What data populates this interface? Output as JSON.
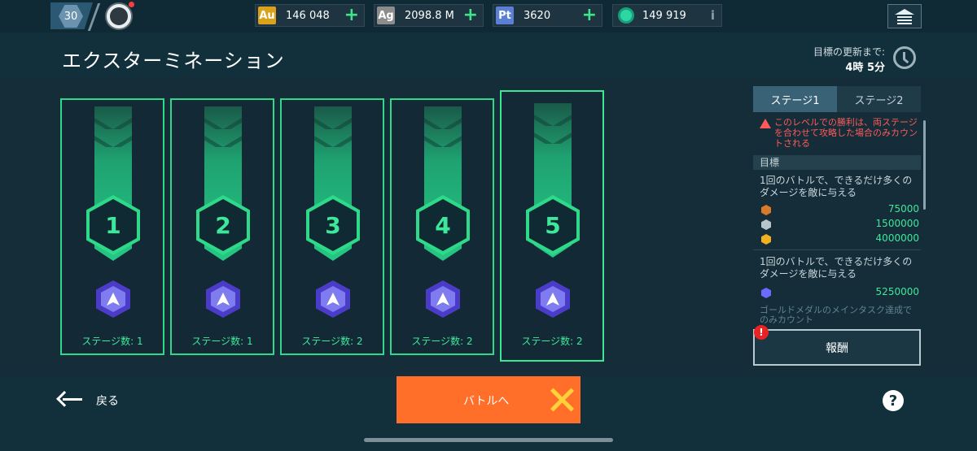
{
  "topbar": {
    "player_level": "30",
    "currencies": [
      {
        "tag": "Au",
        "value": "146 048",
        "color": "#d9a21a"
      },
      {
        "tag": "Ag",
        "value": "2098.8 M",
        "color": "#9a9a9a"
      },
      {
        "tag": "Pt",
        "value": "3620",
        "color": "#5a7fd6"
      }
    ],
    "gems": {
      "value": "149 919",
      "info": "i"
    },
    "icons": [
      "plus-icon",
      "home-icon",
      "gem-icon",
      "info-icon"
    ]
  },
  "header": {
    "title": "エクスターミネーション",
    "refresh_label": "目標の更新まで:",
    "refresh_time": "4時 5分"
  },
  "stages": [
    {
      "number": "1",
      "count": "ステージ数: 1",
      "selected": false
    },
    {
      "number": "2",
      "count": "ステージ数: 1",
      "selected": false
    },
    {
      "number": "3",
      "count": "ステージ数: 2",
      "selected": false
    },
    {
      "number": "4",
      "count": "ステージ数: 2",
      "selected": false
    },
    {
      "number": "5",
      "count": "ステージ数: 2",
      "selected": true
    }
  ],
  "side": {
    "tabs": [
      "ステージ1",
      "ステージ2"
    ],
    "active_tab": "ステージ1",
    "warning": "このレベルでの勝利は、両ステージを合わせて攻略した場合のみカウントされる",
    "goal_header": "目標",
    "objective1": "1回のバトルで、できるだけ多くのダメージを敵に与える",
    "tiers1": [
      {
        "value": "75000",
        "color": "#d97a2a"
      },
      {
        "value": "1500000",
        "color": "#b8c4cc"
      },
      {
        "value": "4000000",
        "color": "#f0b020"
      }
    ],
    "objective2": "1回のバトルで、できるだけ多くのダメージを敵に与える",
    "tiers2": [
      {
        "value": "5250000",
        "color": "#6b6bff"
      }
    ],
    "footnote": "ゴールドメダルのメインタスク達成でのみカウント",
    "reward_button": "報酬",
    "reward_alert": "!"
  },
  "bottom": {
    "back_label": "戻る",
    "battle_label": "バトルへ",
    "help": "?"
  },
  "colors": {
    "accent_green": "#2fd98a",
    "battle_orange": "#ff6f2a",
    "warning_red": "#ff5a5a"
  }
}
